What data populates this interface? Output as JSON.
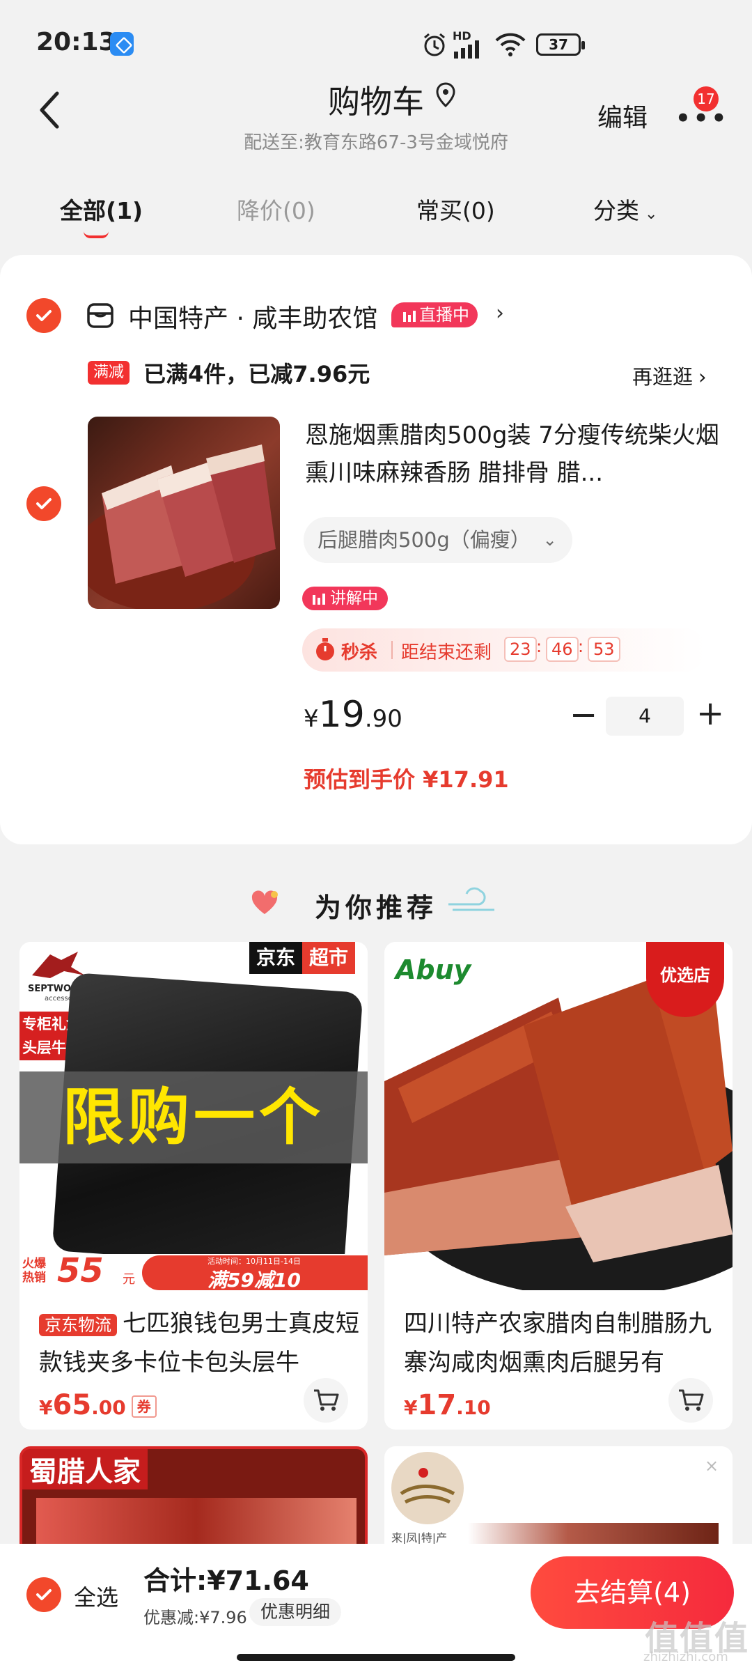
{
  "status_bar": {
    "time": "20:13",
    "signal_hd": "HD",
    "battery": "37"
  },
  "header": {
    "title": "购物车",
    "address": "配送至:教育东路67-3号金域悦府",
    "edit": "编辑",
    "more_badge": "17"
  },
  "tabs": [
    {
      "label": "全部(1)"
    },
    {
      "label": "降价(0)"
    },
    {
      "label": "常买(0)"
    },
    {
      "label": "分类"
    }
  ],
  "shop": {
    "name": "中国特产 · 咸丰助农馆",
    "live_label": "直播中",
    "promo_tag": "满减",
    "promo_text": "已满4件，已减7.96元",
    "stroll": "再逛逛"
  },
  "product": {
    "title": "恩施烟熏腊肉500g装 7分瘦传统柴火烟熏川味麻辣香肠 腊排骨 腊...",
    "spec": "后腿腊肉500g（偏瘦）",
    "explain_label": "讲解中",
    "seckill_label": "秒杀",
    "countdown_label": "距结束还剩",
    "countdown": [
      "23",
      "46",
      "53"
    ],
    "price_symbol": "¥",
    "price_int": "19",
    "price_dec": ".90",
    "quantity": "4",
    "estimate": "预估到手价 ¥17.91"
  },
  "recommend": {
    "title": "为你推荐",
    "items": [
      {
        "img_top_label_a": "京东",
        "img_top_label_b": "超市",
        "img_brand": "SEPTWOLVES",
        "img_brand_sub": "accessories",
        "img_side_tag": "专柜礼盒头层牛皮",
        "img_overlay": "限购一个",
        "img_hot": "火爆热销",
        "img_price": "55",
        "img_price_unit": "元",
        "img_banner_small": "活动时间：10月11日-14日",
        "img_banner": "满59减10",
        "tag": "京东物流",
        "title": "七匹狼钱包男士真皮短款钱夹多卡位卡包头层牛",
        "price_symbol": "¥",
        "price_int": "65",
        "price_dec": ".00",
        "coupon": "券"
      },
      {
        "img_brand": "Abuy",
        "img_corner": "优选店",
        "title": "四川特产农家腊肉自制腊肠九寨沟咸肉烟熏肉后腿另有",
        "price_symbol": "¥",
        "price_int": "17",
        "price_dec": ".10"
      },
      {
        "img_label": "蜀腊人家"
      },
      {
        "img_label": "来|凤|特|产"
      }
    ]
  },
  "bottom": {
    "select_all": "全选",
    "total": "合计:¥71.64",
    "discount": "优惠减:¥7.96",
    "discount_detail": "优惠明细",
    "checkout": "去结算(4)"
  },
  "watermark": {
    "main": "值值值",
    "sub": "zhizhizhi.com"
  },
  "colors": {
    "accent": "#f23030",
    "price": "#e63b2e",
    "checkout": "#f52a3d"
  }
}
